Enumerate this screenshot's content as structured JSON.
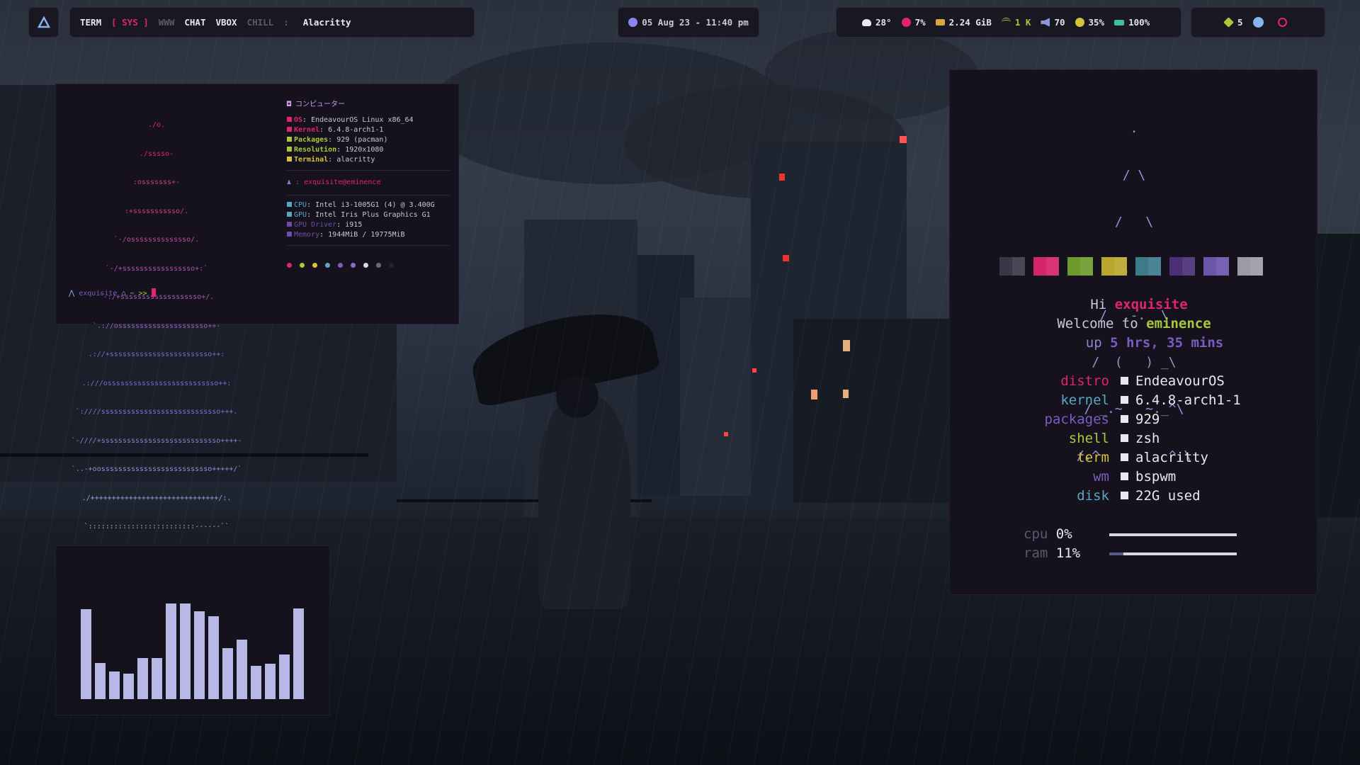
{
  "bar": {
    "workspaces": [
      "TERM",
      "[ SYS ]",
      "WWW",
      "CHAT",
      "VBOX",
      "CHILL"
    ],
    "separator": ":",
    "window_title": "Alacritty",
    "datetime": "05 Aug 23 - 11:40 pm",
    "weather": "28°",
    "cpu": "7%",
    "memory": "2.24 GiB",
    "network": "1 K",
    "volume": "70",
    "brightness": "35%",
    "battery": "100%",
    "updates": "5"
  },
  "fetch": {
    "header": "コンピューター",
    "ascii": [
      "./o.",
      "./sssso-",
      ":osssssss+-",
      ":+sssssssssso/.",
      "`-/ossssssssssssso/.",
      "`-/+sssssssssssssssso+:`",
      "`-:/+sssssssssssssssssso+/.",
      "`.://osssssssssssssssssssso++-",
      ".://+ssssssssssssssssssssssso++:",
      ".:///ossssssssssssssssssssssssso++:",
      "`:////ssssssssssssssssssssssssssso+++.",
      "`-////+ssssssssssssssssssssssssssso++++-",
      "`..-+oossssssssssssssssssssssssso+++++/`",
      "./++++++++++++++++++++++++++++++/:.",
      "`:::::::::::::::::::::::::------``"
    ],
    "rows": [
      {
        "key": "OS",
        "value": ": EndeavourOS Linux x86_64",
        "color": "#e0246f"
      },
      {
        "key": "Kernel",
        "value": ": 6.4.8-arch1-1",
        "color": "#e0246f"
      },
      {
        "key": "Packages",
        "value": ": 929 (pacman)",
        "color": "#a8c93a"
      },
      {
        "key": "Resolution",
        "value": ": 1920x1080",
        "color": "#a8c93a"
      },
      {
        "key": "Terminal",
        "value": ": alacritty",
        "color": "#d7c23c"
      }
    ],
    "user": ": exquisite@eminence",
    "hw_rows": [
      {
        "key": "CPU",
        "value": ": Intel i3-1005G1 (4) @ 3.400G",
        "color": "#5aa7c4"
      },
      {
        "key": "GPU",
        "value": ": Intel Iris Plus Graphics G1",
        "color": "#5aa7c4"
      },
      {
        "key": "GPU Driver",
        "value": ": i915",
        "color": "#6a4fa8"
      },
      {
        "key": "Memory",
        "value": ": 1944MiB / 19775MiB",
        "color": "#6a4fa8"
      }
    ],
    "dots": [
      "#e0246f",
      "#a8c93a",
      "#d7c23c",
      "#5aa7c4",
      "#7b5cc0",
      "#8a6cc8",
      "#d8d8e4",
      "#6a6a7c",
      "#222230"
    ],
    "prompt_user": "exquisite",
    "prompt_tail": "~ >>"
  },
  "sysinfo": {
    "ascii": [
      ".",
      "/ \\",
      "/   \\",
      "/^.   \\",
      "/  .-.  \\",
      "/  (   ) _\\",
      "/ _.~   ~._^\\",
      "/.^         ^.\\"
    ],
    "swatches": [
      "#3a3648",
      "#d6246b",
      "#6e9a2c",
      "#b8a72c",
      "#3d7a8a",
      "#4b2f78",
      "#6b55a8",
      "#9d9aa6"
    ],
    "hi_prefix": "Hi ",
    "hi_name": "exquisite",
    "welcome_prefix": "Welcome to ",
    "welcome_name": "eminence",
    "up_prefix": "up ",
    "uptime": "5 hrs, 35 mins",
    "rows": [
      {
        "label": "distro",
        "value": "EndeavourOS",
        "color": "#e0246f"
      },
      {
        "label": "kernel",
        "value": "6.4.8-arch1-1",
        "color": "#5aa7c4"
      },
      {
        "label": "packages",
        "value": "929",
        "color": "#7b5cc0"
      },
      {
        "label": "shell",
        "value": "zsh",
        "color": "#a8c93a"
      },
      {
        "label": "term",
        "value": "alacritty",
        "color": "#d7c23c"
      },
      {
        "label": "wm",
        "value": "bspwm",
        "color": "#7b5cc0"
      },
      {
        "label": "disk",
        "value": "22G used",
        "color": "#5aa7c4"
      }
    ],
    "cpu_label": "cpu",
    "cpu_value": "0%",
    "cpu_level": 0,
    "ram_label": "ram",
    "ram_value": "11%",
    "ram_level": 0.11
  },
  "visualizer": {
    "levels": [
      0.92,
      0.37,
      0.28,
      0.26,
      0.42,
      0.42,
      0.98,
      0.98,
      0.9,
      0.85,
      0.52,
      0.61,
      0.34,
      0.36,
      0.46,
      0.93
    ]
  }
}
